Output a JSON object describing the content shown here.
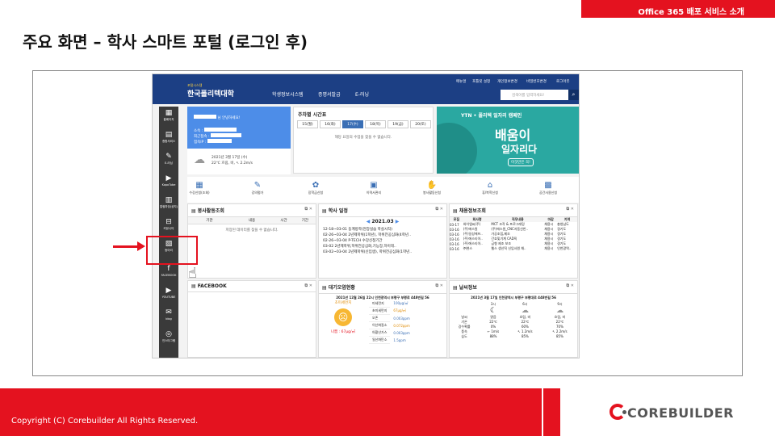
{
  "slide": {
    "top_label": "Office 365 배포 서비스 소개",
    "title": "주요 화면 – 학사 스마트 포털 (로그인 후)",
    "copyright": "Copyright (C) Corebuilder All Rights Reserved.",
    "logo": "COREBUILDER"
  },
  "portal": {
    "logo_small": "포털시스템",
    "logo": "한국폴리텍대학",
    "menu": [
      "학생정보시스템",
      "증명서발급",
      "E-러닝"
    ],
    "util": [
      "메뉴얼",
      "포틀릿 설정",
      "개인정보변경",
      "비밀번호변경",
      "로그아웃"
    ],
    "search_placeholder": "검색어를 입력하세요!",
    "sidebar": [
      {
        "icon": "▦",
        "label": "홈페이지"
      },
      {
        "icon": "▤",
        "label": "종합서비스"
      },
      {
        "icon": "✎",
        "label": "E-러닝"
      },
      {
        "icon": "▶",
        "label": "KopoTube"
      },
      {
        "icon": "▥",
        "label": "알림마당(공지)"
      },
      {
        "icon": "⊟",
        "label": "커뮤니티"
      },
      {
        "icon": "▧",
        "label": "동아리"
      },
      {
        "icon": "f",
        "label": "FACEBOOK"
      },
      {
        "icon": "▶",
        "label": "YOUTUBE"
      },
      {
        "icon": "✉",
        "label": "blog"
      },
      {
        "icon": "◎",
        "label": "인스타그램"
      }
    ],
    "user": {
      "greeting": "님 안녕하세요!",
      "dept": "소속 :",
      "status": "최근접속 :",
      "ip": "접속IP :",
      "date": "2021년 3월 17일 (수)",
      "weather": "22℃ 흐림, 비, ↖ 2.2m/s"
    },
    "weekly": {
      "title": "주차별 시간표",
      "days": [
        "15(월)",
        "16(화)",
        "17(수)",
        "18(목)",
        "19(금)",
        "20(토)"
      ],
      "empty": "해당 요일의 수업을 찾을 수 없습니다."
    },
    "ad": {
      "line1": "YTN • 폴리텍 일자리 캠페인",
      "line2": "배움이",
      "line3": "일자리다",
      "line4": "이것만은 꼭!"
    },
    "services": [
      "수강신청(조회)",
      "강의평가",
      "장학금신청",
      "이력서관리",
      "봉사활동신청",
      "휴/복학신청",
      "공간사용신청"
    ],
    "volunteer": {
      "title": "봉사활동조회",
      "cols": [
        "기관",
        "내용",
        "시간",
        "기간"
      ],
      "empty": "저장된 데이터를 찾을 수 없습니다."
    },
    "schedule": {
      "title": "학사 일정",
      "month": "2021.03",
      "rows": [
        "12-18~03-01  동계방학(현장실습 학실시작)",
        "02-26~03-04  2년제학위(1학년), 학위전공심화(4학년..",
        "02-26~03-04  P-TECH 수강신청기간",
        "03-02  2년제학위,학위전공심화,기능장,하이테..",
        "03-02~03-04  2년제학위(신입생), 학위전공심화(1학년.."
      ]
    },
    "jobs": {
      "title": "채용정보조회",
      "cols": [
        "모집",
        "회사명",
        "직무내용",
        "마감",
        "지역"
      ],
      "rows": [
        [
          "03-17",
          "와이엠씨(주)",
          "MCT 조작 & 프로그래밍",
          "채용시",
          "충청남도"
        ],
        [
          "03-16",
          "(주)에스원",
          "(주)에스원_CNC자동선반..",
          "채용시",
          "경기도"
        ],
        [
          "03-16",
          "(주)일성에프..",
          "가공조립,제조",
          "채용시",
          "경기도"
        ],
        [
          "03-16",
          "(주)에스티아..",
          "간호및기계 CAD직",
          "채용시",
          "경기도"
        ],
        [
          "03-16",
          "(주)에스티아..",
          "금형 제조 보조",
          "채용시",
          "경기도"
        ],
        [
          "03-16",
          "㈜현스",
          "웹스 생산직 신입사원 채..",
          "채용시",
          "인천광역.."
        ]
      ]
    },
    "facebook": {
      "title": "FACEBOOK"
    },
    "air": {
      "title": "대기오염현황",
      "date": "2021년 12월 26일 22시 인천광역시 부평구 부평로 448번길 56",
      "status_label": "초미세먼지",
      "status": "나쁨 : 67μg/㎥",
      "items": [
        [
          "미세먼지",
          "100μg/㎥"
        ],
        [
          "초미세먼지",
          "67μg/㎥"
        ],
        [
          "오존",
          "0.003ppm"
        ],
        [
          "이산화질소",
          "0.072ppm"
        ],
        [
          "아황산가스",
          "0.003ppm"
        ],
        [
          "일산화탄소",
          "1.5ppm"
        ]
      ]
    },
    "weather": {
      "title": "날씨정보",
      "date": "2021년 3월 17일 인천광역시 부평구 부평대로 448번길 56",
      "times": [
        "3시",
        "6시",
        "9시"
      ],
      "rows": [
        [
          "날씨",
          "맑음",
          "흐림, 비",
          "흐림, 비"
        ],
        [
          "기온",
          "22℃",
          "22℃",
          "22℃"
        ],
        [
          "강수확률",
          "0%",
          "60%",
          "70%"
        ],
        [
          "풍속",
          "← 1m/s",
          "↖ 1.2m/s",
          "↖ 2.2m/s"
        ],
        [
          "습도",
          "88%",
          "85%",
          "85%"
        ]
      ]
    }
  }
}
